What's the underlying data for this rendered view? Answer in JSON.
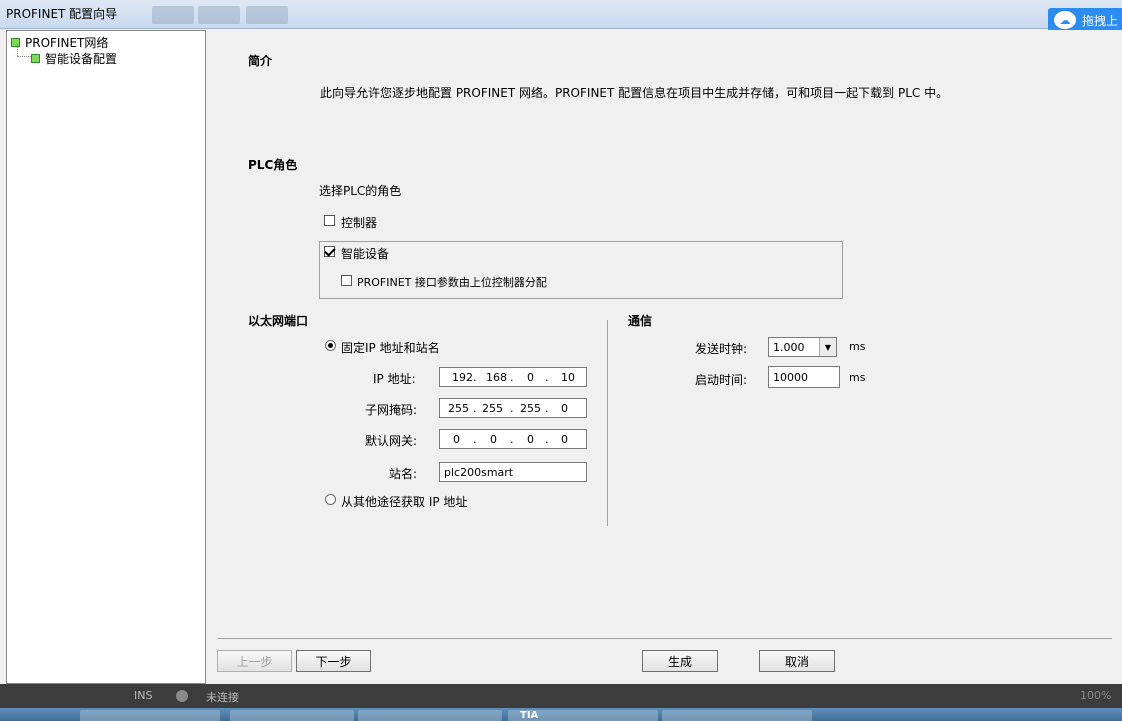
{
  "window": {
    "title": "PROFINET 配置向导"
  },
  "cloud": {
    "icon": "cloud-icon",
    "label": "拖拽上"
  },
  "tree": {
    "root": "PROFINET网络",
    "child": "智能设备配置"
  },
  "intro": {
    "heading": "简介",
    "text": "此向导允许您逐步地配置 PROFINET 网络。PROFINET 配置信息在项目中生成并存储，可和项目一起下载到 PLC 中。"
  },
  "plc_role": {
    "heading": "PLC角色",
    "prompt": "选择PLC的角色",
    "controller": {
      "label": "控制器",
      "checked": false
    },
    "smart_device": {
      "label": "智能设备",
      "checked": true
    },
    "assigned_by_controller": {
      "label": "PROFINET 接口参数由上位控制器分配",
      "checked": false
    }
  },
  "ethernet": {
    "heading": "以太网端口",
    "fixed_ip": {
      "label": "固定IP 地址和站名",
      "selected": true
    },
    "ip_label": "IP 地址:",
    "ip": [
      "192",
      "168",
      "0",
      "10"
    ],
    "mask_label": "子网掩码:",
    "mask": [
      "255",
      "255",
      "255",
      "0"
    ],
    "gateway_label": "默认网关:",
    "gateway": [
      "0",
      "0",
      "0",
      "0"
    ],
    "station_label": "站名:",
    "station_value": "plc200smart",
    "other_ip": {
      "label": "从其他途径获取 IP 地址",
      "selected": false
    }
  },
  "comm": {
    "heading": "通信",
    "send_clock_label": "发送时钟:",
    "send_clock_value": "1.000",
    "send_clock_unit": "ms",
    "startup_label": "启动时间:",
    "startup_value": "10000",
    "startup_unit": "ms"
  },
  "buttons": {
    "prev": "上一步",
    "next": "下一步",
    "generate": "生成",
    "cancel": "取消"
  },
  "status": {
    "ins": "INS",
    "connection": "未连接",
    "zoom": "100%"
  },
  "taskbar": {
    "tia": "TIA"
  }
}
